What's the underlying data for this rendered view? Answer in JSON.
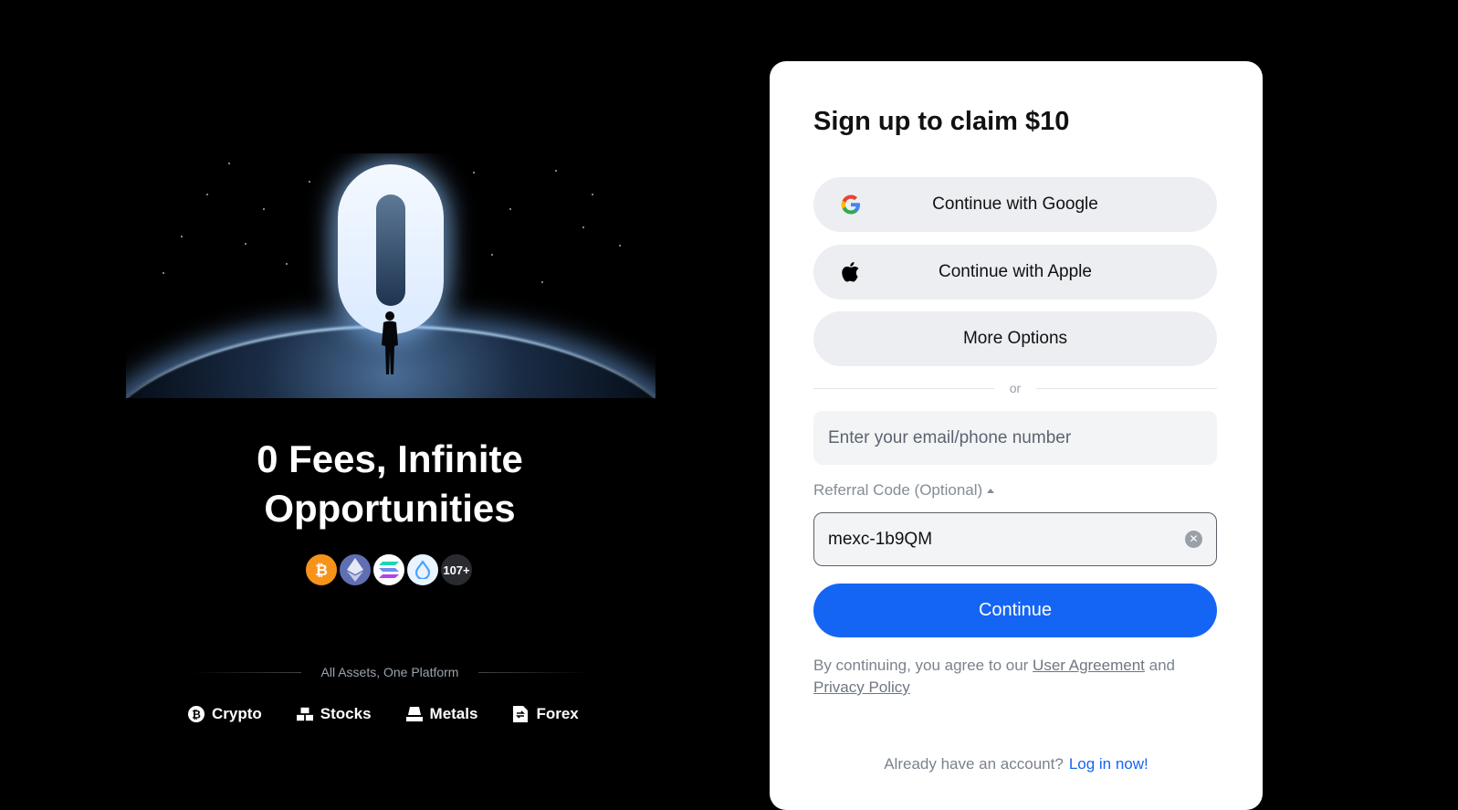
{
  "hero": {
    "title_line1": "0 Fees, Infinite",
    "title_line2": "Opportunities",
    "coins_more": "107+",
    "assets_divider": "All Assets, One Platform",
    "assets": [
      {
        "label": "Crypto",
        "icon": "crypto-icon"
      },
      {
        "label": "Stocks",
        "icon": "stocks-icon"
      },
      {
        "label": "Metals",
        "icon": "metals-icon"
      },
      {
        "label": "Forex",
        "icon": "forex-icon"
      }
    ]
  },
  "signup": {
    "title": "Sign up to claim $10",
    "google_label": "Continue with Google",
    "apple_label": "Continue with Apple",
    "more_label": "More Options",
    "or_label": "or",
    "email_placeholder": "Enter your email/phone number",
    "referral_label": "Referral Code (Optional)",
    "referral_value": "mexc-1b9QM",
    "continue_label": "Continue",
    "legal_prefix": "By continuing, you agree to our ",
    "user_agreement": "User Agreement",
    "legal_and": " and",
    "privacy_policy": "Privacy Policy",
    "have_account": "Already have an account?",
    "login_link": "Log in now!"
  },
  "colors": {
    "accent": "#1565f5",
    "card_bg": "#ffffff",
    "page_bg": "#000000"
  }
}
